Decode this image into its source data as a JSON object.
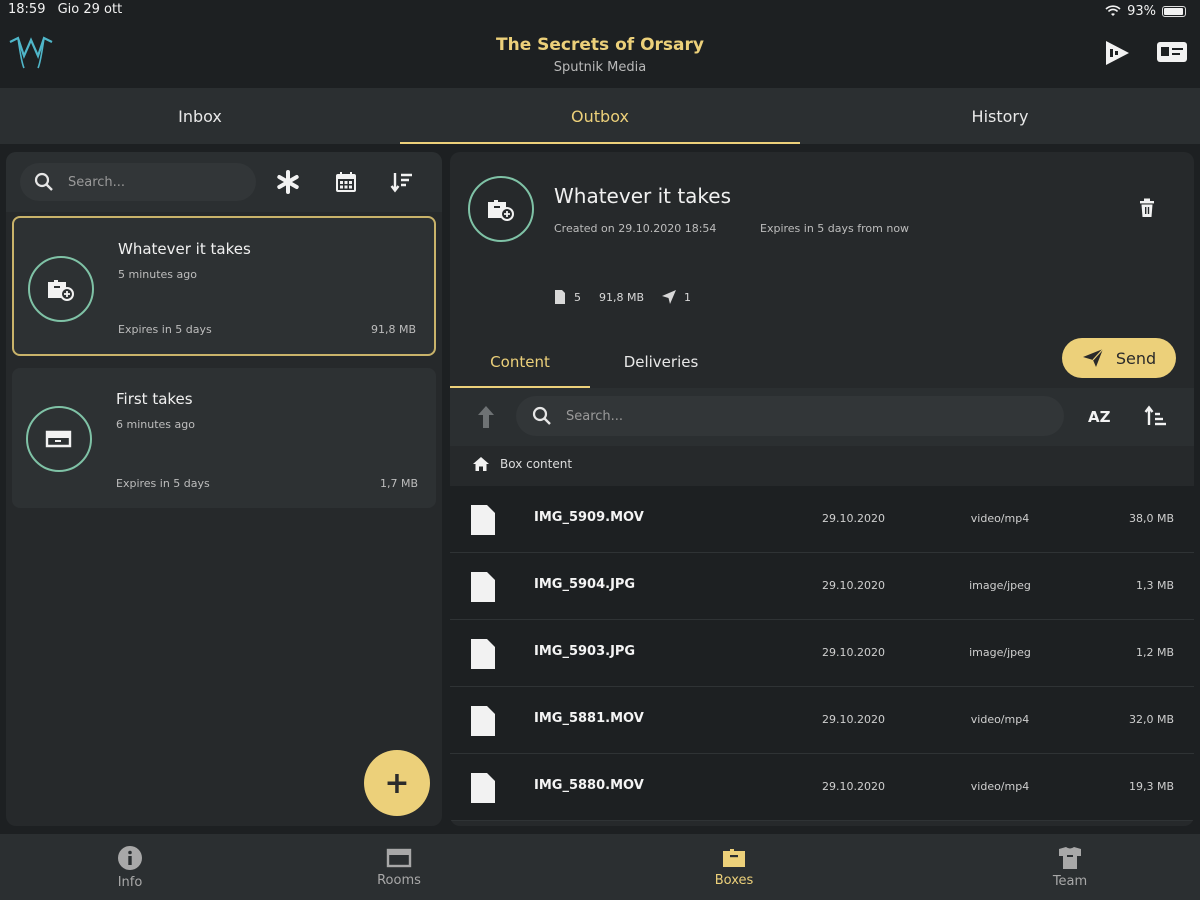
{
  "status": {
    "time": "18:59",
    "date": "Gio 29 ott",
    "battery": "93%",
    "battery_level": 0.93
  },
  "header": {
    "title": "The Secrets of Orsary",
    "subtitle": "Sputnik Media"
  },
  "main_tabs": [
    {
      "label": "Inbox"
    },
    {
      "label": "Outbox"
    },
    {
      "label": "History"
    }
  ],
  "left": {
    "search_placeholder": "Search...",
    "boxes": [
      {
        "title": "Whatever it takes",
        "time": "5 minutes ago",
        "expires": "Expires in 5 days",
        "size": "91,8 MB"
      },
      {
        "title": "First takes",
        "time": "6 minutes ago",
        "expires": "Expires in 5 days",
        "size": "1,7 MB"
      }
    ],
    "fab_label": "+"
  },
  "detail": {
    "title": "Whatever it takes",
    "created": "Created on 29.10.2020   18:54",
    "expires": "Expires in 5 days from now",
    "files_count": "5",
    "total_size": "91,8 MB",
    "sent_count": "1",
    "tabs": [
      {
        "label": "Content"
      },
      {
        "label": "Deliveries"
      }
    ],
    "send_label": "Send",
    "search_placeholder": "Search...",
    "sort_label": "AZ",
    "breadcrumb": "Box content",
    "files": [
      {
        "name": "IMG_5909.MOV",
        "date": "29.10.2020",
        "type": "video/mp4",
        "size": "38,0 MB"
      },
      {
        "name": "IMG_5904.JPG",
        "date": "29.10.2020",
        "type": "image/jpeg",
        "size": "1,3 MB"
      },
      {
        "name": "IMG_5903.JPG",
        "date": "29.10.2020",
        "type": "image/jpeg",
        "size": "1,2 MB"
      },
      {
        "name": "IMG_5881.MOV",
        "date": "29.10.2020",
        "type": "video/mp4",
        "size": "32,0 MB"
      },
      {
        "name": "IMG_5880.MOV",
        "date": "29.10.2020",
        "type": "video/mp4",
        "size": "19,3 MB"
      }
    ]
  },
  "bottom_nav": [
    {
      "label": "Info",
      "icon": "info-icon"
    },
    {
      "label": "Rooms",
      "icon": "rooms-icon"
    },
    {
      "label": "Boxes",
      "icon": "boxes-icon"
    },
    {
      "label": "Team",
      "icon": "team-icon"
    }
  ],
  "colors": {
    "accent": "#ecd07a",
    "teal": "#7fc2a6",
    "background": "#1d2022",
    "panel": "#26292b"
  }
}
